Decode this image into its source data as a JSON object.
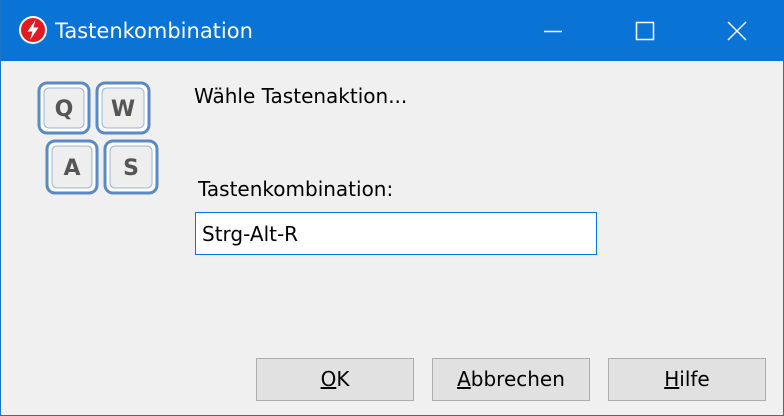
{
  "window": {
    "title": "Tastenkombination",
    "icons": {
      "app": "lightning-bolt-icon",
      "minimize": "minimize-icon",
      "maximize": "maximize-icon",
      "close": "close-icon"
    },
    "colors": {
      "titlebar": "#0a74d6",
      "accent": "#0078d7",
      "app_icon": "#e21b23"
    }
  },
  "illustration": {
    "icon": "keyboard-keys-icon",
    "keys": [
      "Q",
      "W",
      "A",
      "S"
    ]
  },
  "dialog": {
    "prompt": "Wähle Tastenaktion...",
    "field_label": "Tastenkombination:",
    "field_value": "Strg-Alt-R"
  },
  "buttons": {
    "ok": {
      "hotkey": "O",
      "rest": "K"
    },
    "cancel": {
      "hotkey": "A",
      "rest": "bbrechen"
    },
    "help": {
      "hotkey": "H",
      "rest": "ilfe"
    }
  }
}
